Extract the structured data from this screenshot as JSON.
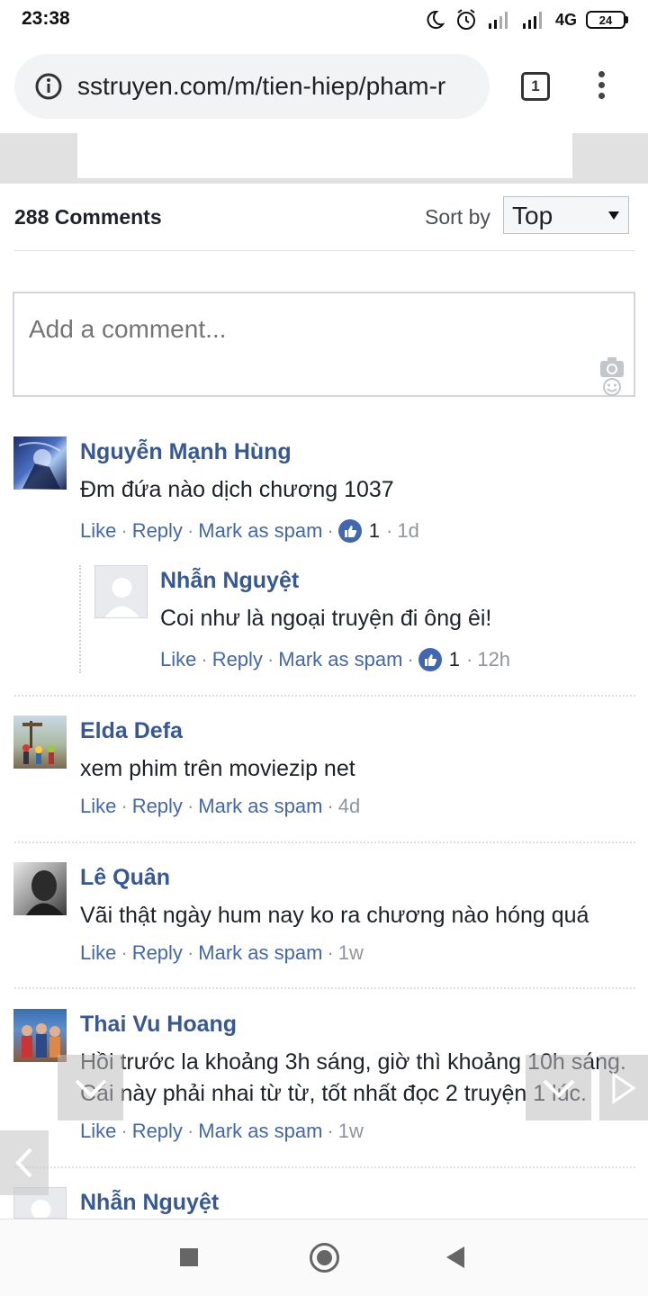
{
  "status_bar": {
    "time": "23:38",
    "network_label": "4G",
    "battery_level": "24"
  },
  "browser": {
    "url": "sstruyen.com/m/tien-hiep/pham-r",
    "tab_count": "1"
  },
  "comments_section": {
    "count_label": "288 Comments",
    "sort_label": "Sort by",
    "sort_value": "Top",
    "composer_placeholder": "Add a comment..."
  },
  "actions": {
    "like": "Like",
    "reply": "Reply",
    "spam": "Mark as spam",
    "sep": "·"
  },
  "comments": [
    {
      "author": "Nguyễn Mạnh Hùng",
      "text": "Đm đứa nào dịch chương 1037",
      "likes": "1",
      "time": "1d",
      "replies": [
        {
          "author": "Nhẫn Nguyệt",
          "text": "Coi như là ngoại truyện đi ông êi!",
          "likes": "1",
          "time": "12h"
        }
      ]
    },
    {
      "author": "Elda Defa",
      "text": "xem phim trên moviezip net",
      "time": "4d"
    },
    {
      "author": "Lê Quân",
      "text": "Vãi thật ngày hum nay ko ra chương nào hóng quá",
      "time": "1w"
    },
    {
      "author": "Thai Vu Hoang",
      "text_line1": "Hồi trước la khoảng 3h sáng, giờ thì khoảng 10h sáng.",
      "text_line2": "Cái này phải nhai từ từ, tốt nhất đọc 2 truyện 1 lúc.",
      "time": "1w"
    },
    {
      "author": "Nhẫn Nguyệt"
    }
  ],
  "colors": {
    "link_blue": "#4267b2",
    "author_blue": "#365899",
    "meta_grey": "#90949c"
  }
}
